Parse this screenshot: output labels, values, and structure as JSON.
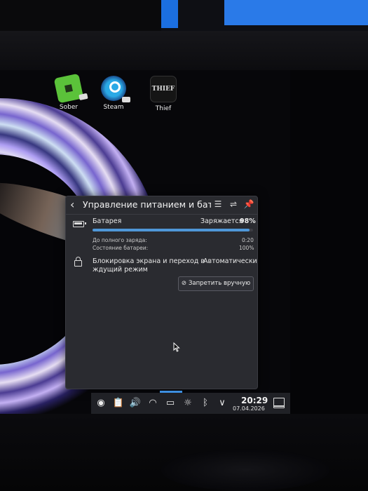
{
  "desktop": {
    "icons": [
      {
        "label": "Sober"
      },
      {
        "label": "Steam"
      },
      {
        "label": "Thief",
        "logo_text": "THIEF"
      }
    ]
  },
  "panel": {
    "title": "Управление питанием и бат...",
    "back_label": "‹",
    "battery": {
      "label": "Батарея",
      "status": "Заряжается",
      "percent": "98%",
      "percent_value": 98,
      "time_to_full_label": "До полного заряда:",
      "time_to_full_value": "0:20",
      "health_label": "Состояние батареи:",
      "health_value": "100%"
    },
    "sleep": {
      "label_line1": "Блокировка экрана и переход в",
      "label_line2": "ждущий режим",
      "value": "Автоматически",
      "button_label": "Запретить вручную"
    }
  },
  "taskbar": {
    "time": "20:29",
    "date": "07.04.2026"
  },
  "colors": {
    "accent": "#4f97d8",
    "panel_bg": "#2a2b30",
    "taskbar_bg": "#202126"
  }
}
